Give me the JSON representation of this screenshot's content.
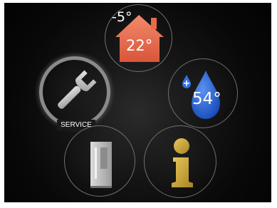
{
  "tiles": {
    "temperature": {
      "outside_temp": "-5°",
      "inside_temp": "22°",
      "icon": "house-icon",
      "color": "#e8694d"
    },
    "water": {
      "temp": "54°",
      "icon": "water-drop-icon",
      "color": "#1e5fd8"
    },
    "service": {
      "label": "SERVICE",
      "icon": "wrench-icon",
      "color": "#c8c8c8"
    },
    "appliance": {
      "icon": "fridge-icon",
      "color": "#bdbdbd"
    },
    "info": {
      "icon": "info-icon",
      "color": "#c9a53a"
    }
  }
}
